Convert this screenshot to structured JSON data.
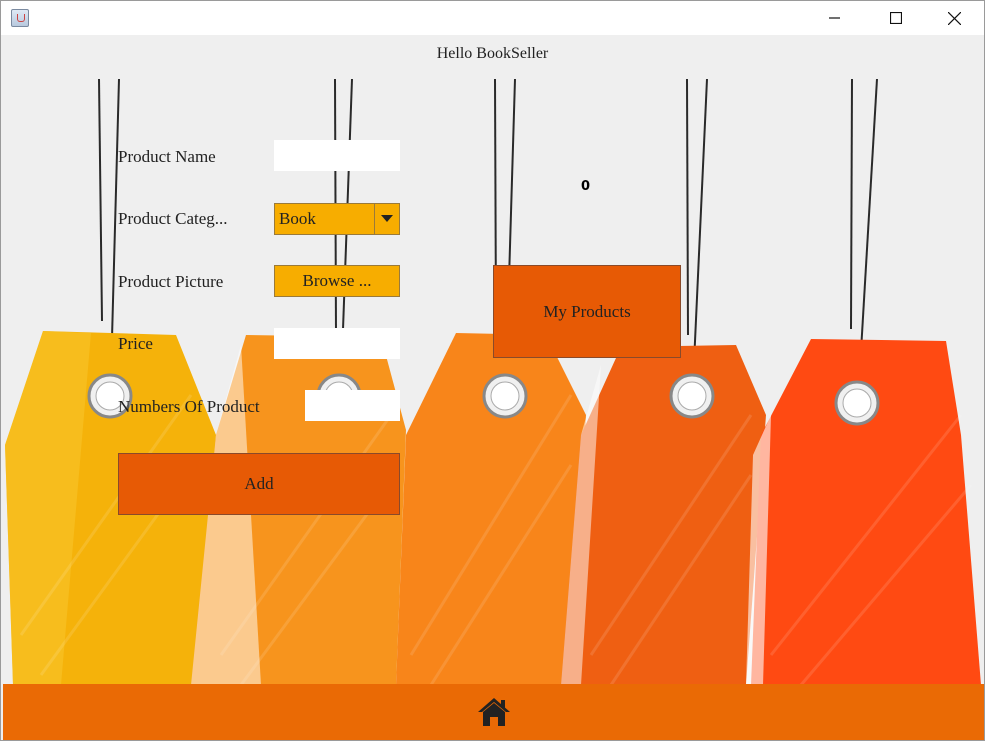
{
  "window": {
    "icon": "java-cup-icon",
    "controls": {
      "minimize": "minimize-icon",
      "maximize": "maximize-icon",
      "close": "close-icon"
    }
  },
  "header": {
    "greeting": "Hello BookSeller"
  },
  "form": {
    "product_name_label": "Product Name",
    "product_name_value": "",
    "category_label": "Product Categ...",
    "category_selected": "Book",
    "picture_label": "Product Picture",
    "browse_label": "Browse ...",
    "price_label": "Price",
    "price_value": "",
    "quantity_label": "Numbers Of Product",
    "quantity_value": "",
    "add_label": "Add"
  },
  "counter": {
    "value": "0"
  },
  "my_products_label": "My Products",
  "footer": {
    "home_icon": "home-icon"
  },
  "colors": {
    "button_orange": "#e75a05",
    "combo_yellow": "#f7ad00",
    "footer_orange": "#ea6a05",
    "tag_yellow": "#f5b20a",
    "tag_orange": "#f7941d",
    "tag_red": "#ff4a12"
  }
}
